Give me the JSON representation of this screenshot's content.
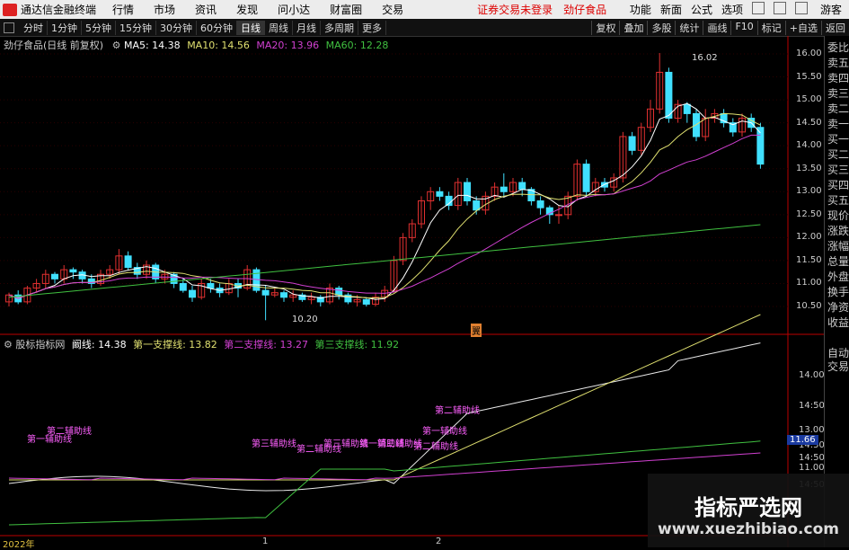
{
  "menubar": {
    "app_title": "通达信金融终端",
    "items": [
      "行情",
      "市场",
      "资讯",
      "发现",
      "问小达",
      "财富圈",
      "交易"
    ],
    "status": "证券交易未登录",
    "stock": "劲仔食品",
    "right_items": [
      "功能",
      "新面",
      "公式",
      "选项"
    ],
    "guest": "游客"
  },
  "toolbar": {
    "periods": [
      "分时",
      "1分钟",
      "5分钟",
      "15分钟",
      "30分钟",
      "60分钟",
      "日线",
      "周线",
      "月线",
      "多周期",
      "更多"
    ],
    "active": "日线",
    "right": [
      "复权",
      "叠加",
      "多股",
      "统计",
      "画线",
      "F10",
      "标记",
      "+自选",
      "返回"
    ]
  },
  "main_legend": {
    "title": "劲仔食品(日线 前复权)",
    "ma5": "MA5: 14.38",
    "ma10": "MA10: 14.56",
    "ma20": "MA20: 13.96",
    "ma60": "MA60: 12.28"
  },
  "ind_legend": {
    "title": "股标指标网",
    "l1": "阚线: 14.38",
    "l2": "第一支撑线: 13.82",
    "l3": "第二支撑线: 13.27",
    "l4": "第三支撑线: 11.92"
  },
  "price_axis": [
    "16.00",
    "15.50",
    "15.00",
    "14.50",
    "14.00",
    "13.50",
    "13.00",
    "12.50",
    "12.00",
    "11.50",
    "11.00",
    "10.50"
  ],
  "ind_axis": [
    "14.00",
    "14:50",
    "13.00",
    "14:50",
    "14:50",
    "11.00",
    "14:50"
  ],
  "ind_highlight": "11.66",
  "annotations": {
    "high": "16.02",
    "low": "10.20",
    "marker": "翼"
  },
  "ind_labels": [
    "第二辅助线",
    "第一辅助线",
    "第三辅助线",
    "第二辅助线",
    "第三辅助线",
    "第一辅助线",
    "第三辅助线",
    "第二辅助线",
    "第一辅助线",
    "第二辅助线"
  ],
  "right_panel": [
    "委比",
    "卖五",
    "卖四",
    "卖三",
    "卖二",
    "卖一",
    "买一",
    "买二",
    "买三",
    "买四",
    "买五",
    "现价",
    "涨跌",
    "涨幅",
    "总量",
    "外盘",
    "换手",
    "净资",
    "收益"
  ],
  "right_panel_bottom": [
    "自动",
    "交易"
  ],
  "x_axis": [
    "2022年",
    "1",
    "2"
  ],
  "watermark": {
    "line1": "指标严选网",
    "line2": "www.xuezhibiao.com"
  },
  "colors": {
    "up": "#e03030",
    "down": "#40e0ff",
    "ma5": "#ffffff",
    "ma10": "#e0e070",
    "ma20": "#d040d0",
    "ma60": "#40c040"
  },
  "chart_data": {
    "type": "candlestick",
    "price_range": [
      10.2,
      16.1
    ],
    "candles": [
      [
        10.6,
        10.75,
        10.5,
        10.8
      ],
      [
        10.75,
        10.6,
        10.55,
        10.85
      ],
      [
        10.6,
        10.9,
        10.55,
        10.95
      ],
      [
        10.9,
        11.0,
        10.8,
        11.1
      ],
      [
        11.0,
        11.2,
        10.9,
        11.3
      ],
      [
        11.2,
        11.1,
        11.0,
        11.25
      ],
      [
        11.1,
        11.3,
        11.0,
        11.4
      ],
      [
        11.3,
        11.25,
        11.1,
        11.35
      ],
      [
        11.25,
        11.1,
        11.0,
        11.3
      ],
      [
        11.1,
        11.0,
        10.9,
        11.2
      ],
      [
        11.0,
        11.2,
        10.95,
        11.3
      ],
      [
        11.2,
        11.3,
        11.1,
        11.4
      ],
      [
        11.3,
        11.6,
        11.2,
        11.75
      ],
      [
        11.6,
        11.35,
        11.3,
        11.7
      ],
      [
        11.35,
        11.2,
        11.1,
        11.45
      ],
      [
        11.2,
        11.4,
        11.1,
        11.5
      ],
      [
        11.4,
        11.1,
        11.0,
        11.45
      ],
      [
        11.1,
        11.2,
        11.0,
        11.3
      ],
      [
        11.2,
        11.0,
        10.9,
        11.25
      ],
      [
        11.0,
        10.85,
        10.8,
        11.1
      ],
      [
        10.85,
        10.7,
        10.6,
        10.95
      ],
      [
        10.7,
        11.0,
        10.65,
        11.1
      ],
      [
        11.0,
        10.9,
        10.8,
        11.1
      ],
      [
        10.9,
        10.8,
        10.7,
        11.0
      ],
      [
        10.8,
        11.0,
        10.75,
        11.1
      ],
      [
        11.0,
        10.9,
        10.7,
        11.1
      ],
      [
        10.9,
        11.3,
        10.85,
        11.4
      ],
      [
        11.3,
        10.85,
        10.8,
        11.35
      ],
      [
        10.85,
        10.75,
        10.2,
        10.95
      ],
      [
        10.75,
        10.8,
        10.7,
        10.9
      ],
      [
        10.8,
        10.7,
        10.6,
        10.85
      ],
      [
        10.7,
        10.75,
        10.6,
        10.85
      ],
      [
        10.75,
        10.65,
        10.6,
        10.8
      ],
      [
        10.65,
        10.7,
        10.55,
        10.8
      ],
      [
        10.7,
        10.6,
        10.5,
        10.75
      ],
      [
        10.6,
        10.9,
        10.55,
        11.0
      ],
      [
        10.9,
        10.75,
        10.65,
        10.95
      ],
      [
        10.75,
        10.6,
        10.55,
        10.8
      ],
      [
        10.6,
        10.65,
        10.5,
        10.75
      ],
      [
        10.65,
        10.55,
        10.5,
        10.7
      ],
      [
        10.55,
        10.7,
        10.5,
        10.8
      ],
      [
        10.7,
        10.85,
        10.6,
        10.95
      ],
      [
        10.85,
        11.5,
        10.8,
        11.6
      ],
      [
        11.5,
        12.0,
        11.4,
        12.1
      ],
      [
        12.0,
        12.3,
        11.9,
        12.4
      ],
      [
        12.3,
        12.8,
        12.2,
        12.9
      ],
      [
        12.8,
        13.0,
        12.6,
        13.1
      ],
      [
        13.0,
        12.9,
        12.8,
        13.1
      ],
      [
        12.9,
        12.7,
        12.6,
        13.0
      ],
      [
        12.7,
        13.2,
        12.6,
        13.3
      ],
      [
        13.2,
        12.8,
        12.7,
        13.3
      ],
      [
        12.8,
        12.6,
        12.5,
        12.9
      ],
      [
        12.6,
        12.9,
        12.5,
        13.0
      ],
      [
        12.9,
        13.1,
        12.8,
        13.2
      ],
      [
        13.1,
        13.0,
        12.9,
        13.4
      ],
      [
        13.0,
        13.2,
        12.9,
        13.3
      ],
      [
        13.2,
        13.05,
        12.9,
        13.3
      ],
      [
        13.05,
        12.8,
        12.7,
        13.1
      ],
      [
        12.8,
        12.65,
        12.5,
        12.9
      ],
      [
        12.65,
        12.5,
        12.3,
        12.7
      ],
      [
        12.5,
        12.5,
        12.3,
        12.7
      ],
      [
        12.5,
        12.9,
        12.4,
        13.0
      ],
      [
        12.9,
        13.6,
        12.8,
        13.7
      ],
      [
        13.6,
        13.0,
        12.9,
        13.7
      ],
      [
        13.0,
        13.2,
        12.9,
        13.3
      ],
      [
        13.2,
        13.1,
        13.0,
        13.3
      ],
      [
        13.1,
        13.3,
        13.0,
        13.4
      ],
      [
        13.3,
        14.2,
        13.2,
        14.3
      ],
      [
        14.2,
        13.9,
        13.8,
        14.3
      ],
      [
        13.9,
        14.4,
        13.8,
        14.5
      ],
      [
        14.4,
        14.8,
        14.3,
        15.0
      ],
      [
        14.8,
        15.6,
        14.7,
        16.02
      ],
      [
        15.6,
        14.6,
        14.5,
        15.7
      ],
      [
        14.6,
        14.9,
        14.5,
        15.0
      ],
      [
        14.9,
        14.7,
        14.5,
        14.95
      ],
      [
        14.7,
        14.2,
        14.1,
        14.8
      ],
      [
        14.2,
        14.6,
        14.1,
        14.8
      ],
      [
        14.6,
        14.7,
        14.5,
        14.8
      ],
      [
        14.7,
        14.5,
        14.4,
        14.8
      ],
      [
        14.5,
        14.3,
        14.2,
        14.6
      ],
      [
        14.3,
        14.6,
        14.2,
        14.7
      ],
      [
        14.6,
        14.4,
        14.3,
        14.7
      ],
      [
        14.4,
        13.6,
        13.5,
        14.5
      ]
    ]
  }
}
